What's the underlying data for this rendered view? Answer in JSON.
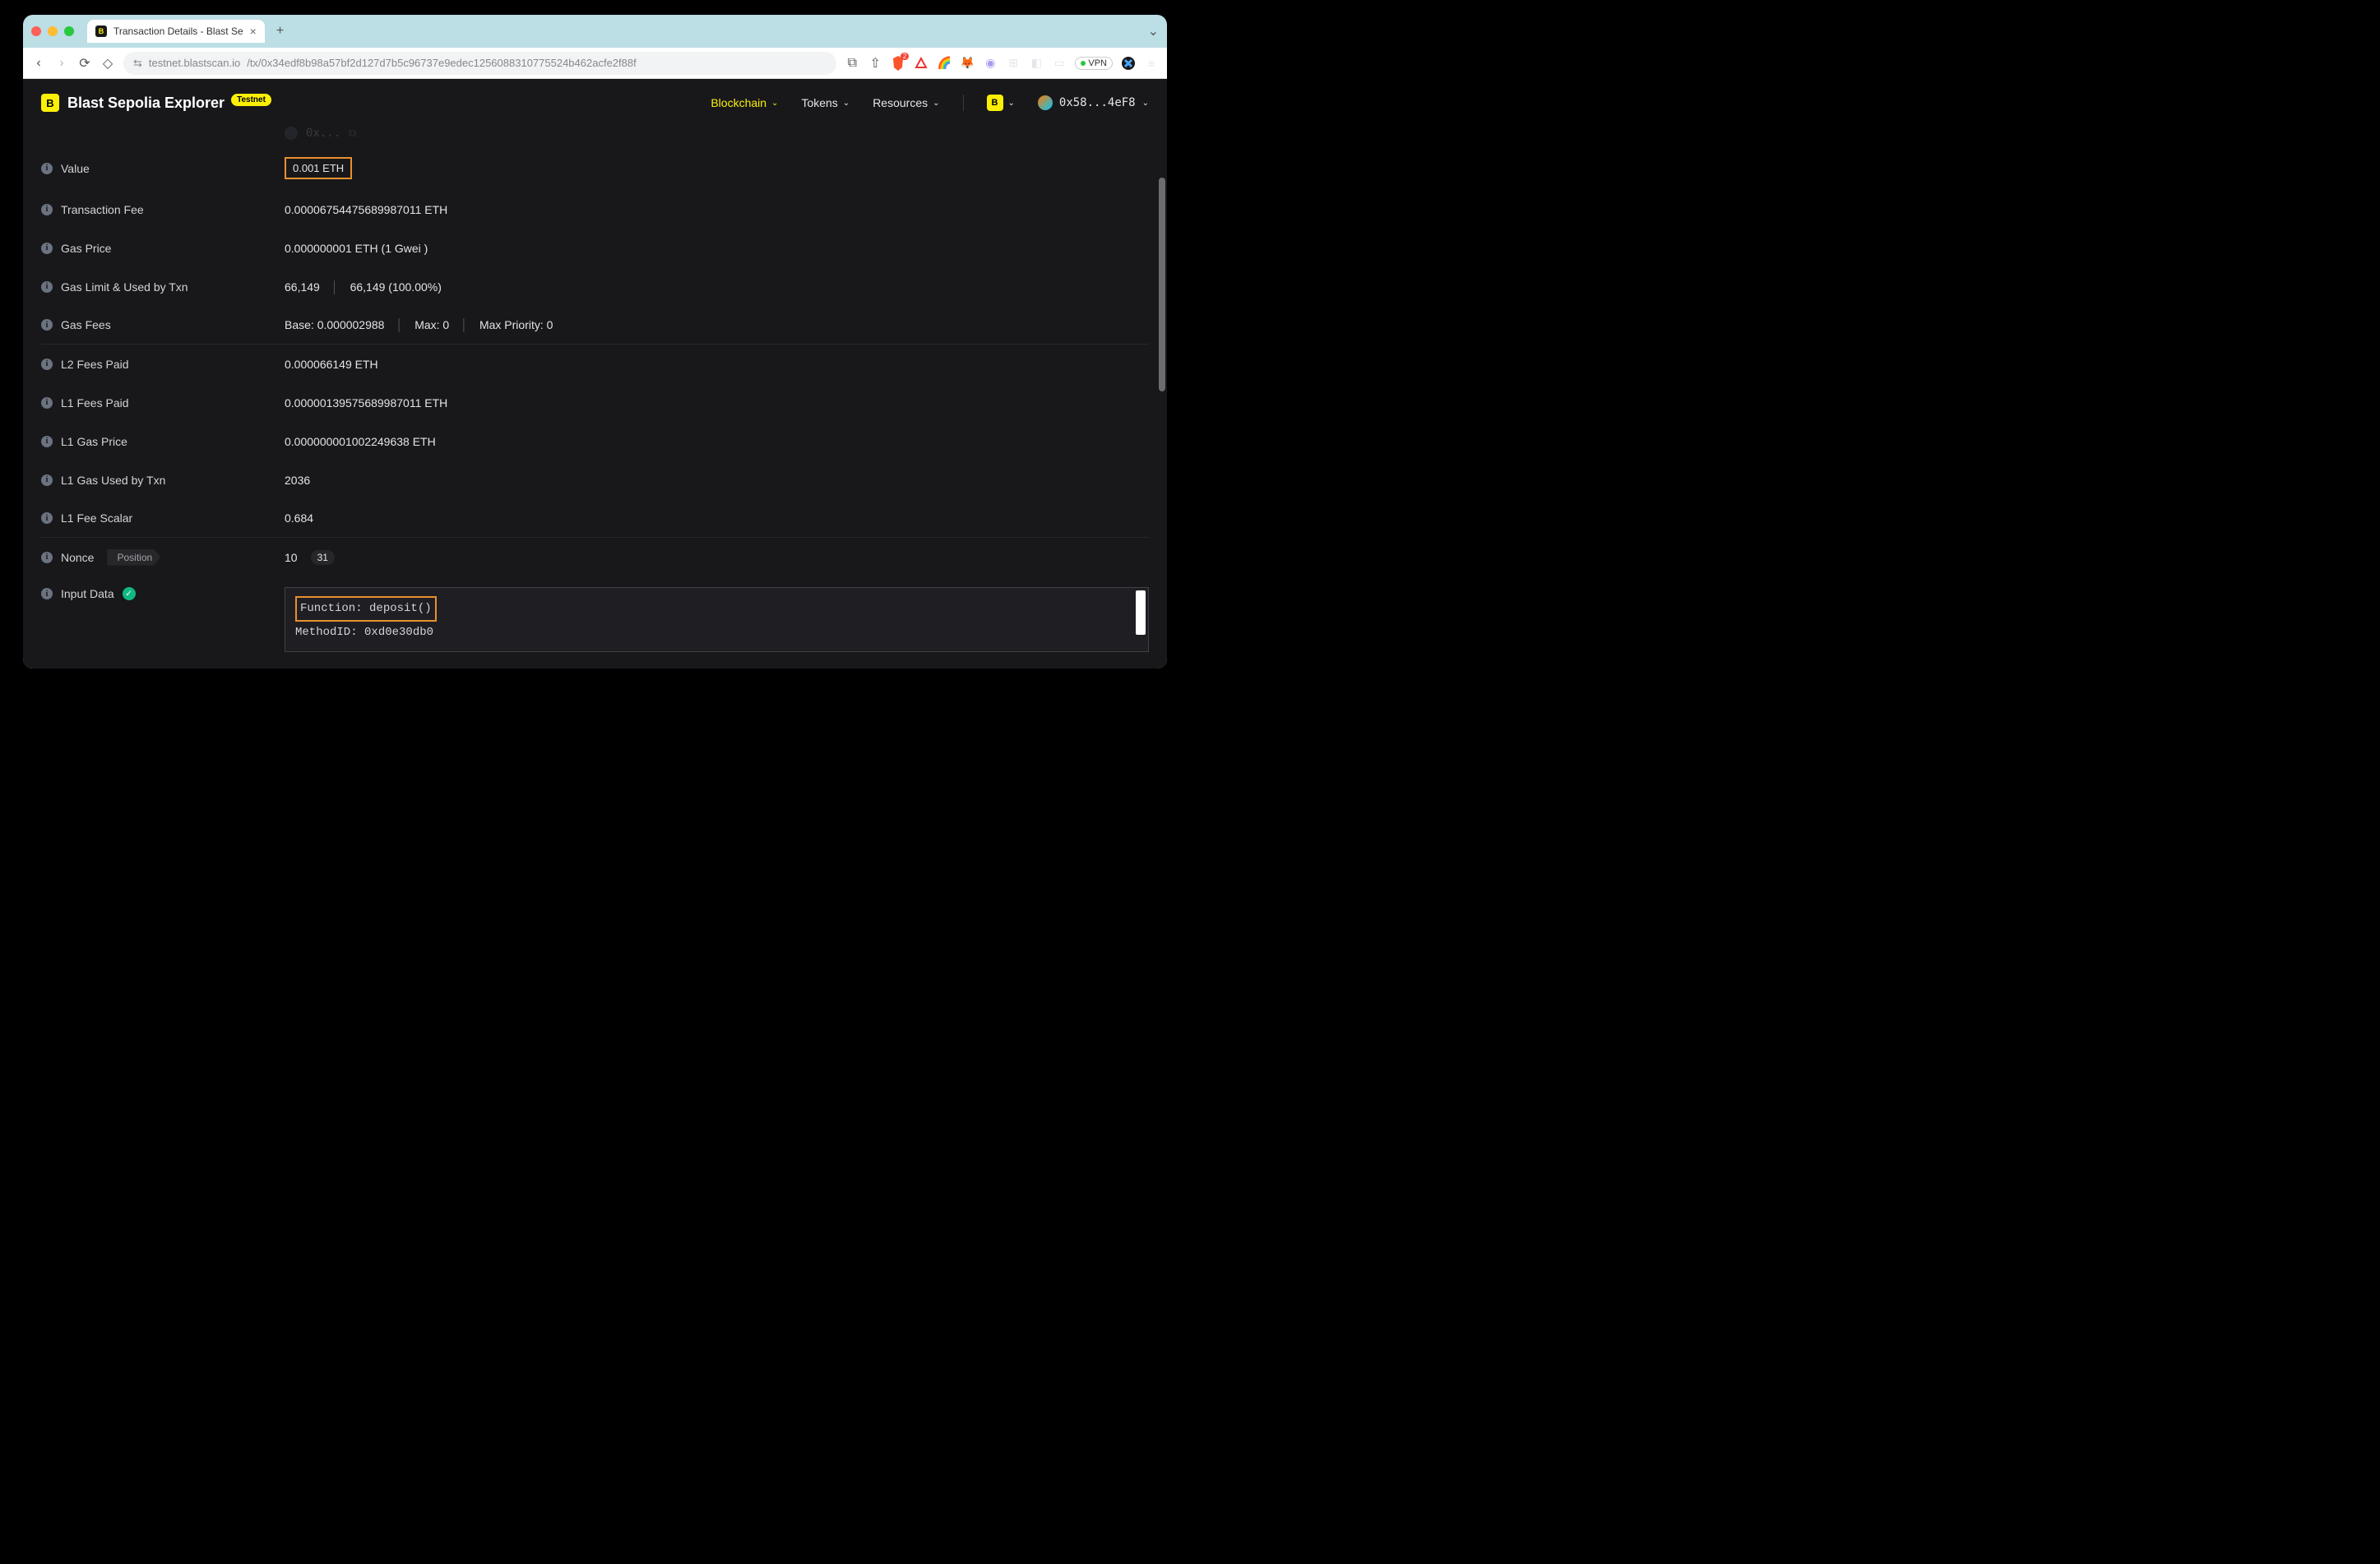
{
  "browser": {
    "tab_title": "Transaction Details - Blast Se",
    "url_host": "testnet.blastscan.io",
    "url_path": "/tx/0x34edf8b98a57bf2d127d7b5c96737e9edec1256088310775524b462acfe2f88f",
    "vpn_label": "VPN",
    "brave_count": "2"
  },
  "header": {
    "title": "Blast Sepolia Explorer",
    "badge": "Testnet",
    "nav_blockchain": "Blockchain",
    "nav_tokens": "Tokens",
    "nav_resources": "Resources",
    "wallet_short": "0x58...4eF8"
  },
  "rows": {
    "value_label": "Value",
    "value_val": "0.001 ETH",
    "txfee_label": "Transaction Fee",
    "txfee_val": "0.00006754475689987011 ETH",
    "gasprice_label": "Gas Price",
    "gasprice_val": "0.000000001 ETH (1 Gwei )",
    "gaslimit_label": "Gas Limit & Used by Txn",
    "gaslimit_v1": "66,149",
    "gaslimit_v2": "66,149 (100.00%)",
    "gasfees_label": "Gas Fees",
    "gasfees_base": "Base: 0.000002988",
    "gasfees_max": "Max: 0",
    "gasfees_maxp": "Max Priority: 0",
    "l2fees_label": "L2 Fees Paid",
    "l2fees_val": "0.000066149 ETH",
    "l1fees_label": "L1 Fees Paid",
    "l1fees_val": "0.00000139575689987011 ETH",
    "l1gasprice_label": "L1 Gas Price",
    "l1gasprice_val": "0.000000001002249638 ETH",
    "l1gasused_label": "L1 Gas Used by Txn",
    "l1gasused_val": "2036",
    "l1scalar_label": "L1 Fee Scalar",
    "l1scalar_val": "0.684",
    "nonce_label": "Nonce",
    "nonce_pos": "Position",
    "nonce_val": "10",
    "nonce_idx": "31",
    "input_label": "Input Data",
    "input_fn": "Function: deposit()",
    "input_method": "MethodID: 0xd0e30db0"
  }
}
